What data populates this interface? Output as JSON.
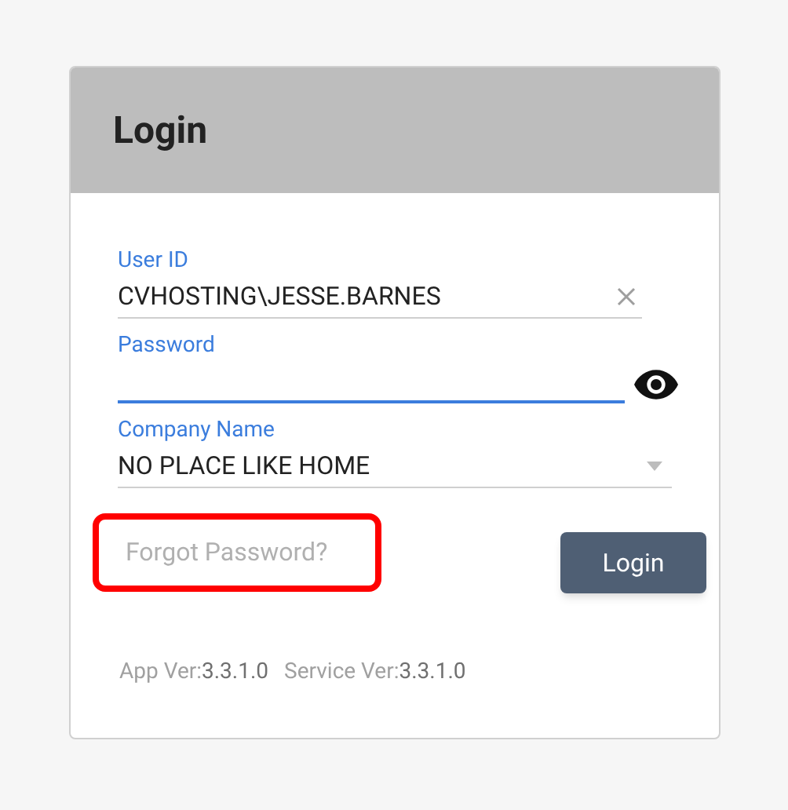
{
  "card": {
    "title": "Login"
  },
  "fields": [
    {
      "kind": "clearable",
      "label": "User ID",
      "value": "CVHOSTING\\JESSE.BARNES",
      "focused": false
    },
    {
      "kind": "password",
      "label": "Password",
      "focused": true
    },
    {
      "kind": "select",
      "label": "Company Name",
      "value": "NO PLACE LIKE HOME",
      "focused": false
    }
  ],
  "forgot_link": {
    "label": "Forgot Password?",
    "highlighted": true
  },
  "login_button": {
    "label": "Login"
  },
  "versions": [
    {
      "label": "App Ver:",
      "value": "3.3.1.0"
    },
    {
      "label": "Service Ver:",
      "value": "3.3.1.0"
    }
  ]
}
